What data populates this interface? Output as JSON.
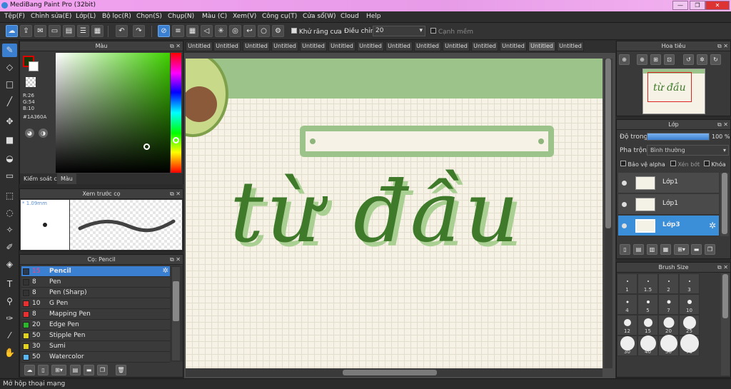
{
  "window": {
    "title": "MediBang Paint Pro (32bit)"
  },
  "menu": [
    "Tệp(F)",
    "Chỉnh sửa(E)",
    "Lớp(L)",
    "Bộ lọc(R)",
    "Chọn(S)",
    "Chụp(N)",
    "Màu (C)",
    "Xem(V)",
    "Công cụ(T)",
    "Cửa sổ(W)",
    "Cloud",
    "Help"
  ],
  "toolbar": {
    "antialias_label": "Khử răng cưa",
    "correction_label": "Điều chỉnh",
    "correction_value": "20",
    "soft_edge_label": "Cạnh mềm"
  },
  "color_panel": {
    "title": "Màu",
    "r": "R:26",
    "g": "G:54",
    "b": "B:10",
    "hex": "#1A360A",
    "fg_color": "#1a360a",
    "tab_control": "Kiểm soát cọ",
    "tab_color": "Màu"
  },
  "preview_panel": {
    "title": "Xem trước cọ",
    "size": "* 1.09mm"
  },
  "brush_panel": {
    "title": "Cọ: Pencil",
    "brushes": [
      {
        "size": "15",
        "name": "Pencil",
        "color": "#2a3a52"
      },
      {
        "size": "8",
        "name": "Pen",
        "color": "#333333"
      },
      {
        "size": "8",
        "name": "Pen (Sharp)",
        "color": "#333333"
      },
      {
        "size": "10",
        "name": "G Pen",
        "color": "#e83030"
      },
      {
        "size": "8",
        "name": "Mapping Pen",
        "color": "#e83030"
      },
      {
        "size": "20",
        "name": "Edge Pen",
        "color": "#2cb52c"
      },
      {
        "size": "50",
        "name": "Stipple Pen",
        "color": "#e0d020"
      },
      {
        "size": "30",
        "name": "Sumi",
        "color": "#e0d020"
      },
      {
        "size": "50",
        "name": "Watercolor",
        "color": "#5ab4f0"
      }
    ]
  },
  "tabs": [
    "Untitled",
    "Untitled",
    "Untitled",
    "Untitled",
    "Untitled",
    "Untitled",
    "Untitled",
    "Untitled",
    "Untitled",
    "Untitled",
    "Untitled",
    "Untitled",
    "Untitled",
    "Untitled"
  ],
  "canvas": {
    "text": "từ đầu",
    "text_color": "#3f7a2a",
    "header_color": "#9cc48a"
  },
  "navigator": {
    "title": "Hoa tiêu",
    "thumb_text": "từ đầu"
  },
  "layer_panel": {
    "title": "Lớp",
    "opacity_label": "Độ trong",
    "opacity_value": "100 %",
    "blend_label": "Pha trộn",
    "blend_value": "Bình thường",
    "protect_alpha": "Bảo vệ alpha",
    "clip": "Xén bớt",
    "lock": "Khóa",
    "layers": [
      "Lớp1",
      "Lớp1",
      "Lớp3"
    ]
  },
  "brush_size_panel": {
    "title": "Brush Size",
    "sizes": [
      "1",
      "1.5",
      "2",
      "3",
      "4",
      "5",
      "7",
      "10",
      "12",
      "15",
      "20",
      "25",
      "30",
      "40",
      "50",
      "70"
    ]
  },
  "status": {
    "text": "Mở hộp thoại mạng"
  },
  "colors": {
    "accent": "#3b7fd0",
    "panel": "#393939",
    "canvas_bg": "#f6f3e6"
  }
}
